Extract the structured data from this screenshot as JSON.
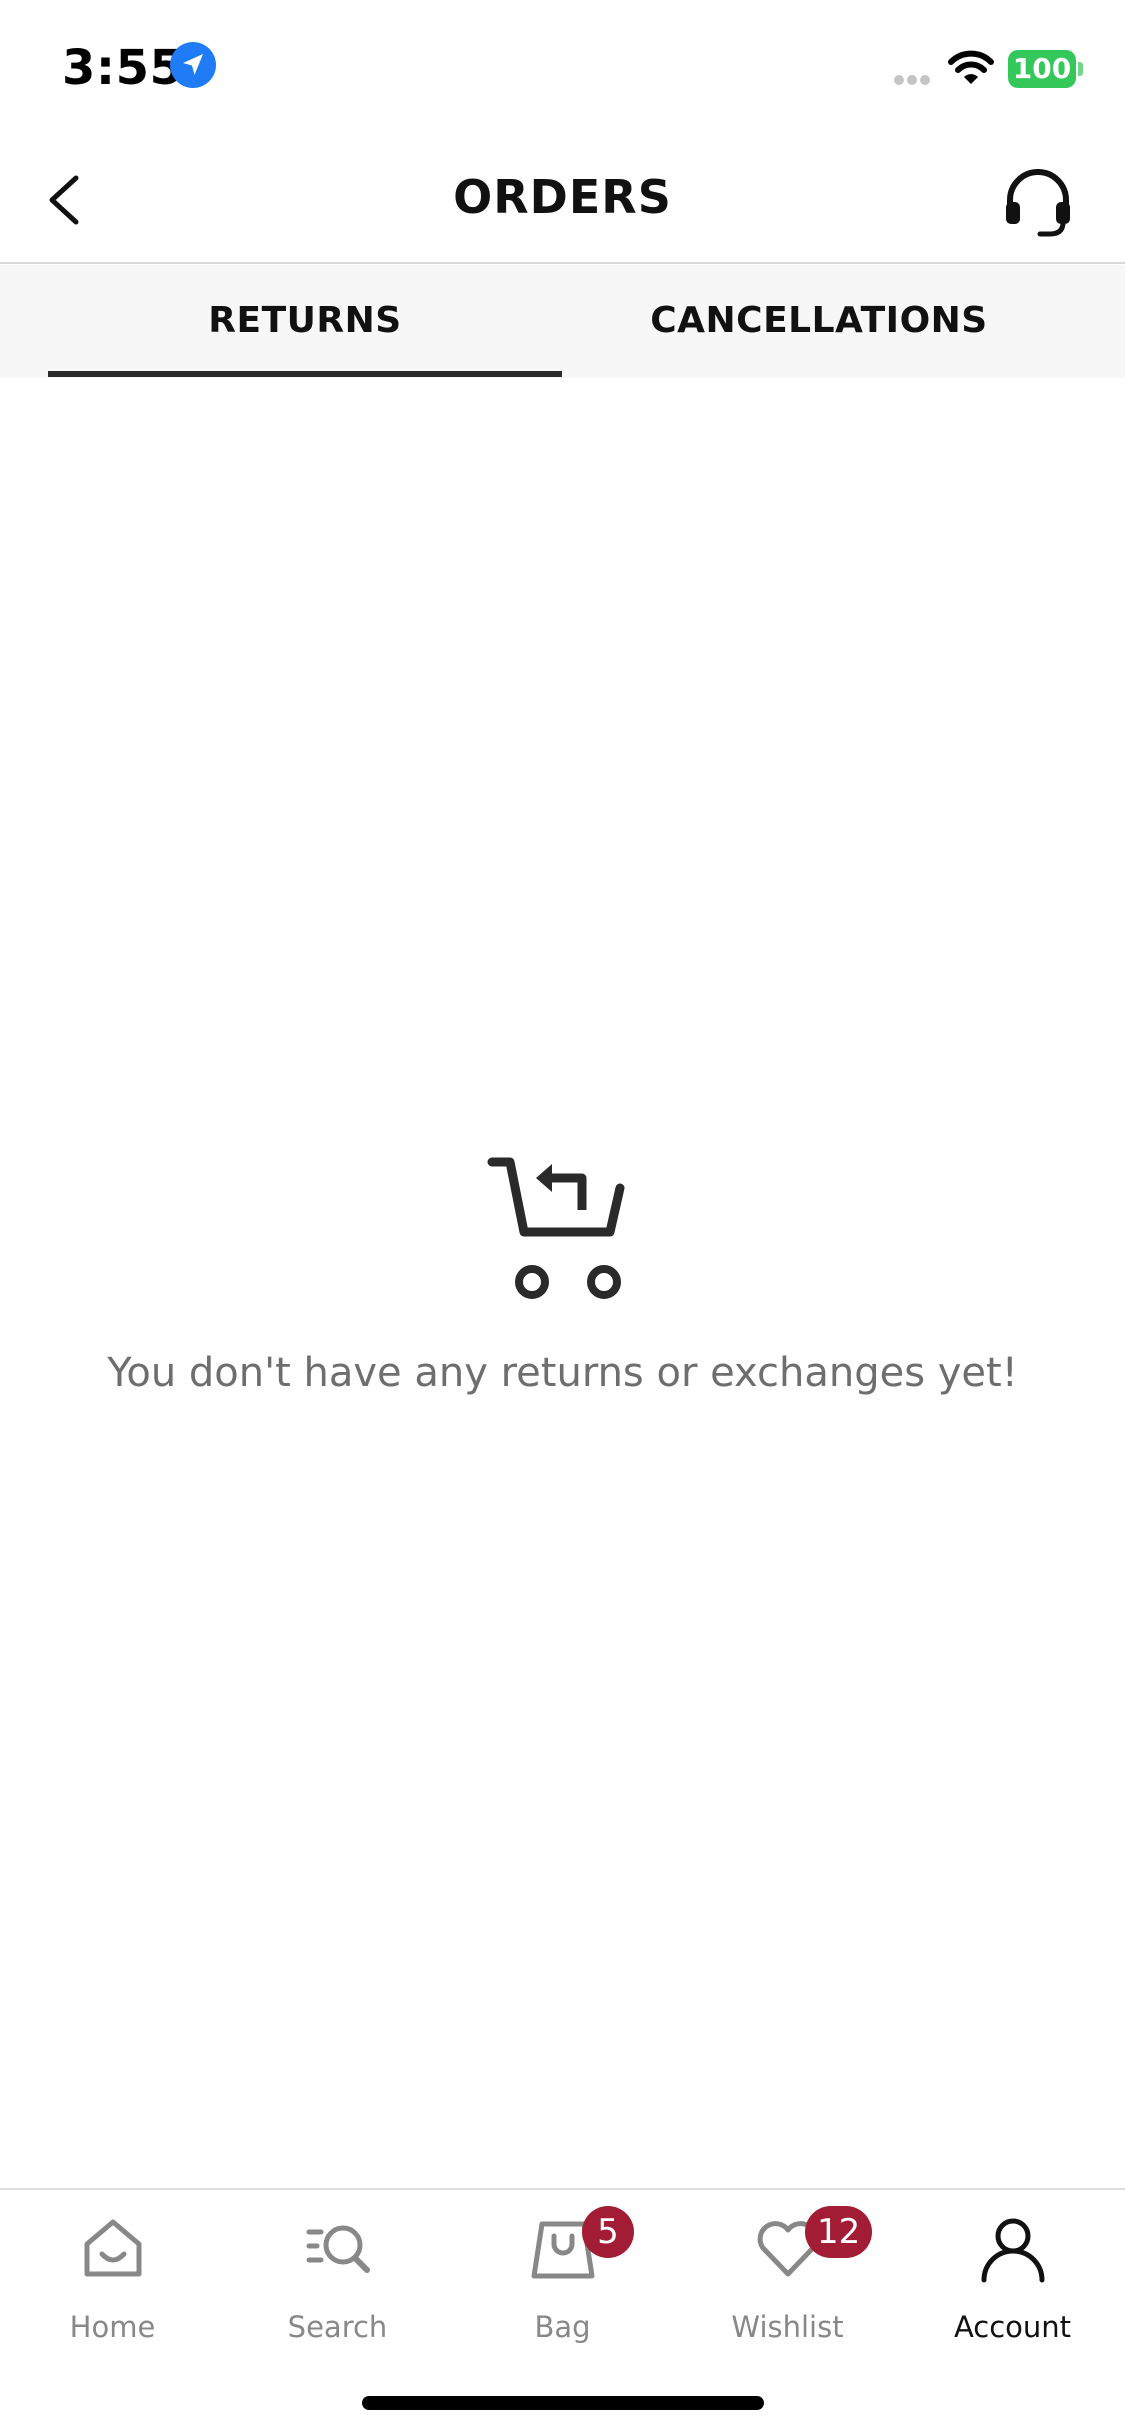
{
  "status_bar": {
    "time": "3:55",
    "battery": "100",
    "colors": {
      "battery": "#34c759",
      "location": "#1f7cf6"
    }
  },
  "header": {
    "title": "ORDERS",
    "back_icon": "chevron-left-icon",
    "support_icon": "headset-icon"
  },
  "tabs": {
    "items": [
      {
        "label": "RETURNS",
        "active": true
      },
      {
        "label": "CANCELLATIONS",
        "active": false
      }
    ]
  },
  "empty_state": {
    "icon": "cart-return-icon",
    "message": "You don't have any returns or exchanges yet!"
  },
  "bottom_nav": {
    "items": [
      {
        "label": "Home",
        "icon": "home-icon",
        "active": false
      },
      {
        "label": "Search",
        "icon": "search-icon",
        "active": false
      },
      {
        "label": "Bag",
        "icon": "bag-icon",
        "active": false,
        "badge": "5"
      },
      {
        "label": "Wishlist",
        "icon": "heart-icon",
        "active": false,
        "badge": "12"
      },
      {
        "label": "Account",
        "icon": "account-icon",
        "active": true
      }
    ],
    "colors": {
      "badge": "#a31c35",
      "inactive": "#888888",
      "active": "#111111"
    }
  }
}
